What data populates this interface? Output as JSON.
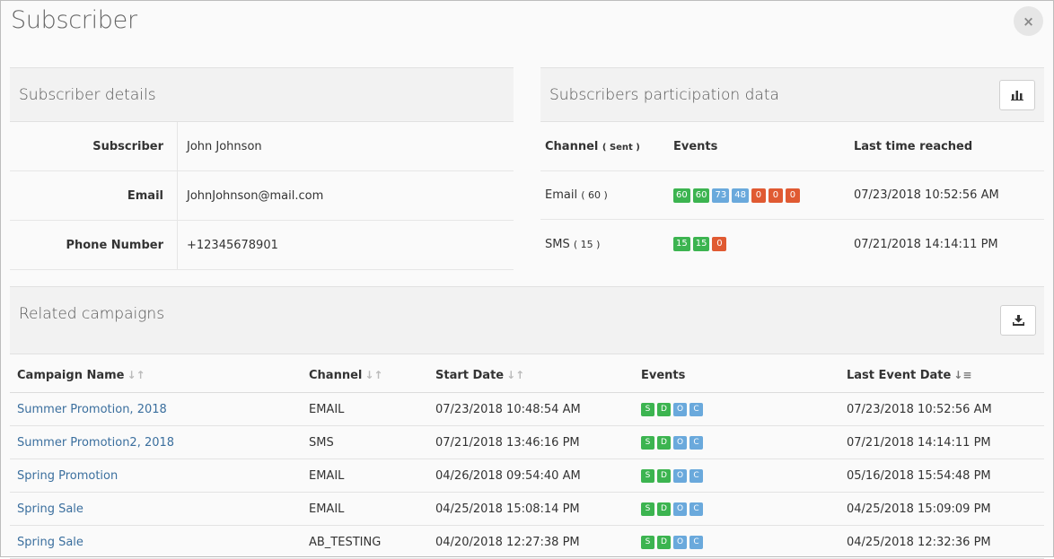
{
  "modal": {
    "title": "Subscriber",
    "close_icon": "×"
  },
  "details": {
    "heading": "Subscriber details",
    "rows": [
      {
        "label": "Subscriber",
        "value": "John Johnson"
      },
      {
        "label": "Email",
        "value": "JohnJohnson@mail.com"
      },
      {
        "label": "Phone Number",
        "value": "+12345678901"
      }
    ]
  },
  "participation": {
    "heading": "Subscribers participation data",
    "columns": {
      "channel": "Channel",
      "sent": "( Sent )",
      "events": "Events",
      "last": "Last time reached"
    },
    "rows": [
      {
        "channel": "Email",
        "count": "( 60 )",
        "badges": [
          {
            "v": "60",
            "c": "green"
          },
          {
            "v": "60",
            "c": "green"
          },
          {
            "v": "73",
            "c": "blue"
          },
          {
            "v": "48",
            "c": "blue"
          },
          {
            "v": "0",
            "c": "red"
          },
          {
            "v": "0",
            "c": "red"
          },
          {
            "v": "0",
            "c": "red"
          }
        ],
        "last": "07/23/2018 10:52:56 AM"
      },
      {
        "channel": "SMS",
        "count": "( 15 )",
        "badges": [
          {
            "v": "15",
            "c": "green"
          },
          {
            "v": "15",
            "c": "green"
          },
          {
            "v": "0",
            "c": "red"
          }
        ],
        "last": "07/21/2018 14:14:11 PM"
      }
    ]
  },
  "campaigns": {
    "heading": "Related campaigns",
    "columns": {
      "name": "Campaign Name",
      "channel": "Channel",
      "start": "Start Date",
      "events": "Events",
      "last": "Last Event Date"
    },
    "rows": [
      {
        "name": "Summer Promotion, 2018",
        "channel": "EMAIL",
        "start": "07/23/2018 10:48:54 AM",
        "last": "07/23/2018 10:52:56 AM"
      },
      {
        "name": "Summer Promotion2, 2018",
        "channel": "SMS",
        "start": "07/21/2018 13:46:16 PM",
        "last": "07/21/2018 14:14:11 PM"
      },
      {
        "name": "Spring Promotion",
        "channel": "EMAIL",
        "start": "04/26/2018 09:54:40 AM",
        "last": "05/16/2018 15:54:48 PM"
      },
      {
        "name": "Spring Sale",
        "channel": "EMAIL",
        "start": "04/25/2018 15:08:14 PM",
        "last": "04/25/2018 15:09:09 PM"
      },
      {
        "name": "Spring Sale",
        "channel": "AB_TESTING",
        "start": "04/20/2018 12:27:38 PM",
        "last": "04/25/2018 12:32:36 PM"
      }
    ],
    "event_badges": [
      {
        "v": "S",
        "c": "green"
      },
      {
        "v": "D",
        "c": "green"
      },
      {
        "v": "O",
        "c": "blue"
      },
      {
        "v": "C",
        "c": "blue"
      }
    ]
  },
  "colors": {
    "green": "#3cb450",
    "blue": "#6aa9dc",
    "red": "#e05a32",
    "link": "#3b6f9e"
  },
  "icons": {
    "chart": "bar-chart-icon",
    "download": "download-icon",
    "sort": "sort-icon"
  }
}
